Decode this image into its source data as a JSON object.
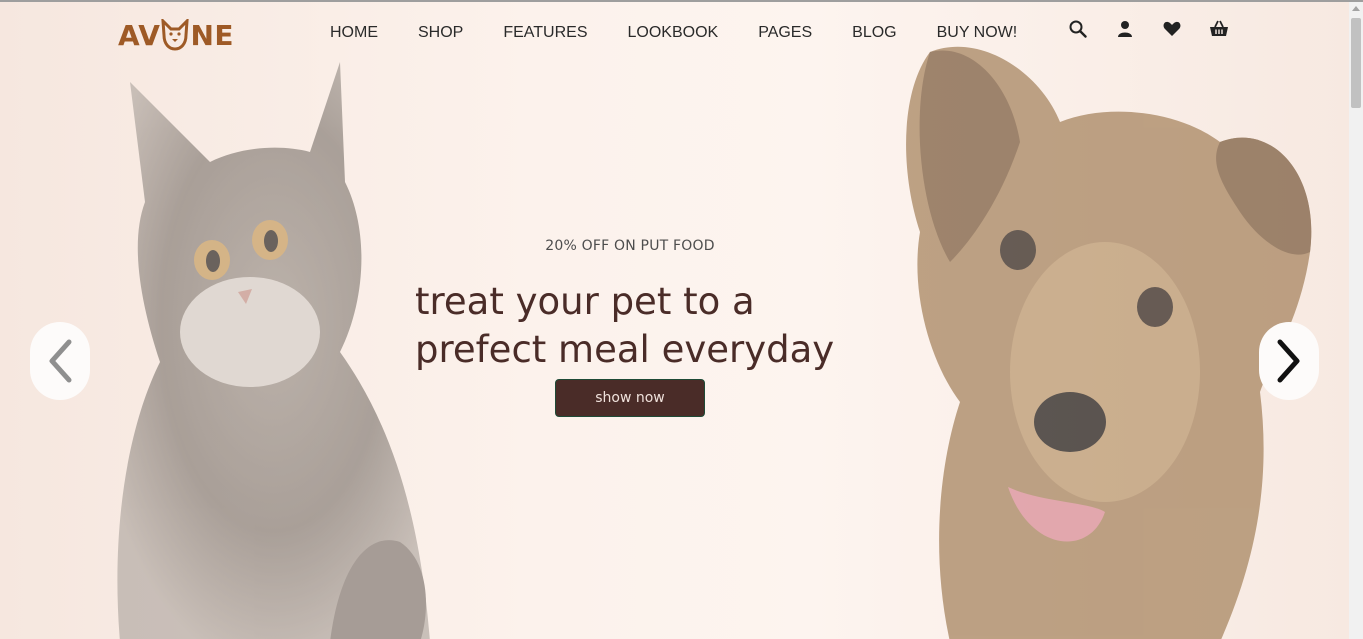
{
  "brand": {
    "logo_left": "AV",
    "logo_right": "NE",
    "color": "#9e5a26"
  },
  "nav": {
    "items": [
      {
        "label": "HOME"
      },
      {
        "label": "SHOP"
      },
      {
        "label": "FEATURES"
      },
      {
        "label": "LOOKBOOK"
      },
      {
        "label": "PAGES"
      },
      {
        "label": "BLOG"
      },
      {
        "label": "BUY NOW!"
      }
    ]
  },
  "header_icons": [
    "search-icon",
    "user-icon",
    "heart-icon",
    "basket-icon"
  ],
  "hero": {
    "promo": "20% OFF ON PUT FOOD",
    "headline_line1": "treat your pet to a",
    "headline_line2": "prefect meal everyday",
    "button_label": "show now",
    "accent": "#4a2c28",
    "images": [
      "cat-photo",
      "dog-photo"
    ]
  },
  "carousel": {
    "prev": "chevron-left-icon",
    "next": "chevron-right-icon"
  }
}
